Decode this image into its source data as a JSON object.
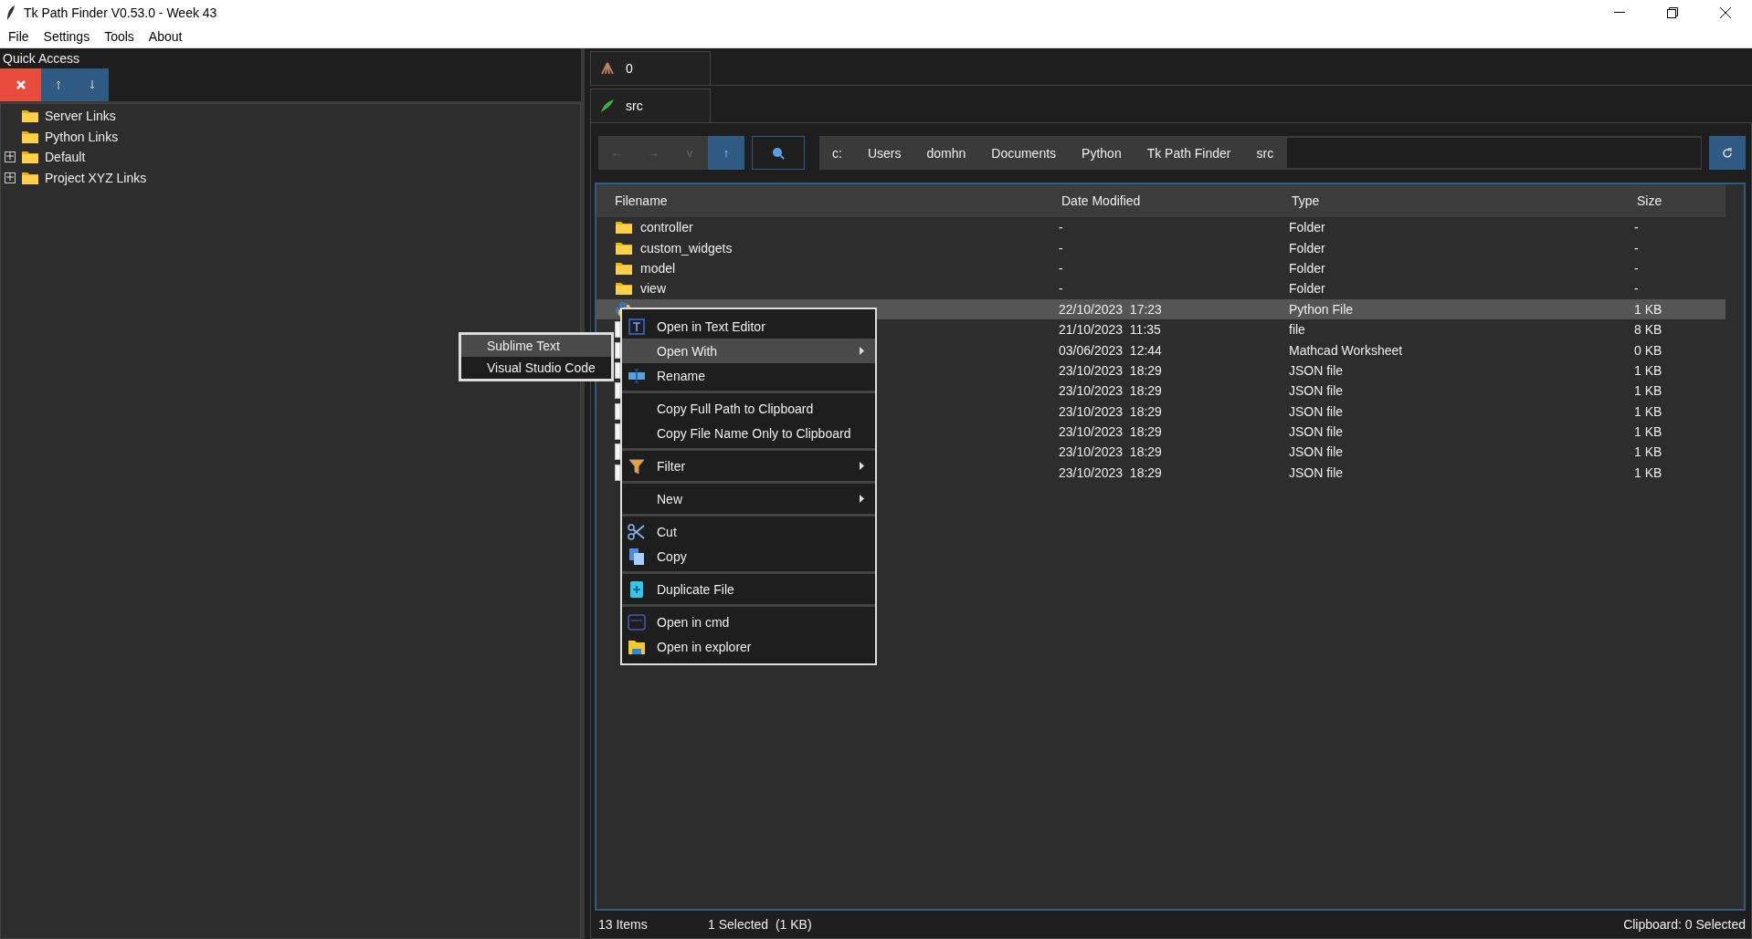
{
  "window": {
    "title": "Tk Path Finder V0.53.0 - Week 43"
  },
  "menu_bar": [
    "File",
    "Settings",
    "Tools",
    "About"
  ],
  "quick_access": {
    "title": "Quick Access",
    "tree": [
      {
        "label": "Server Links"
      },
      {
        "label": "Python Links"
      },
      {
        "label": "Default",
        "expanded": false
      },
      {
        "label": "Project XYZ Links",
        "expanded": false
      }
    ]
  },
  "outer_tabs": [
    {
      "label": "0",
      "selected": true
    }
  ],
  "inner_tabs": [
    {
      "label": "src",
      "selected": true
    }
  ],
  "nav_buttons": [
    {
      "label": "←",
      "disabled": true
    },
    {
      "label": "→",
      "disabled": true
    },
    {
      "label": "v",
      "disabled": true
    },
    {
      "label": "↑",
      "disabled": false
    }
  ],
  "breadcrumbs": [
    "c:",
    "Users",
    "domhn",
    "Documents",
    "Python",
    "Tk Path Finder",
    "src"
  ],
  "table": {
    "columns": [
      "Filename",
      "Date Modified",
      "Type",
      "Size"
    ],
    "rows": [
      {
        "kind": "folder",
        "filename": "controller",
        "date": "-",
        "type": "Folder",
        "size": "-",
        "selected": false
      },
      {
        "kind": "folder",
        "filename": "custom_widgets",
        "date": "-",
        "type": "Folder",
        "size": "-",
        "selected": false
      },
      {
        "kind": "folder",
        "filename": "model",
        "date": "-",
        "type": "Folder",
        "size": "-",
        "selected": false
      },
      {
        "kind": "folder",
        "filename": "view",
        "date": "-",
        "type": "Folder",
        "size": "-",
        "selected": false
      },
      {
        "kind": "python",
        "date": "22/10/2023  17:23",
        "type": "Python File",
        "size": "1 KB",
        "selected": true
      },
      {
        "kind": "file",
        "date": "21/10/2023  11:35",
        "type": "file",
        "size": "8 KB",
        "selected": false
      },
      {
        "kind": "file",
        "date": "03/06/2023  12:44",
        "type": "Mathcad Worksheet",
        "size": "0 KB",
        "selected": false
      },
      {
        "kind": "file",
        "date": "23/10/2023  18:29",
        "type": "JSON file",
        "size": "1 KB",
        "selected": false
      },
      {
        "kind": "file",
        "date": "23/10/2023  18:29",
        "type": "JSON file",
        "size": "1 KB",
        "selected": false
      },
      {
        "kind": "file",
        "date": "23/10/2023  18:29",
        "type": "JSON file",
        "size": "1 KB",
        "selected": false
      },
      {
        "kind": "file",
        "date": "23/10/2023  18:29",
        "type": "JSON file",
        "size": "1 KB",
        "selected": false
      },
      {
        "kind": "file",
        "date": "23/10/2023  18:29",
        "type": "JSON file",
        "size": "1 KB",
        "selected": false
      },
      {
        "kind": "file",
        "date": "23/10/2023  18:29",
        "type": "JSON file",
        "size": "1 KB",
        "selected": false
      }
    ]
  },
  "context_menu": {
    "sections": [
      [
        {
          "label": "Open in Text Editor",
          "selected": false,
          "submenu": false
        },
        {
          "label": "Open With",
          "selected": true,
          "submenu": true
        },
        {
          "label": "Rename",
          "selected": false,
          "submenu": false
        }
      ],
      [
        {
          "label": "Copy Full Path to Clipboard",
          "selected": false,
          "submenu": false
        },
        {
          "label": "Copy File Name Only to Clipboard",
          "selected": false,
          "submenu": false
        }
      ],
      [
        {
          "label": "Filter",
          "selected": false,
          "submenu": true
        }
      ],
      [
        {
          "label": "New",
          "selected": false,
          "submenu": true
        }
      ],
      [
        {
          "label": "Cut",
          "selected": false,
          "submenu": false
        },
        {
          "label": "Copy",
          "selected": false,
          "submenu": false
        }
      ],
      [
        {
          "label": "Duplicate File",
          "selected": false,
          "submenu": false
        }
      ],
      [
        {
          "label": "Open in cmd",
          "selected": false,
          "submenu": false
        },
        {
          "label": "Open in explorer",
          "selected": false,
          "submenu": false
        }
      ]
    ]
  },
  "submenu": [
    {
      "label": "Sublime Text",
      "selected": true
    },
    {
      "label": "Visual Studio Code",
      "selected": false
    }
  ],
  "status_bar": {
    "items": "13 Items",
    "selection": "1 Selected  (1 KB)",
    "clipboard": "Clipboard: 0 Selected"
  }
}
